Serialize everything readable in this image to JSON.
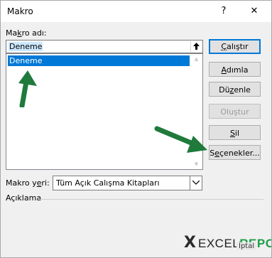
{
  "window": {
    "title": "Makro",
    "help_label": "?",
    "close_label": "✕"
  },
  "macro_name": {
    "label_pre": "Ma",
    "label_accel": "k",
    "label_post": "ro adı:",
    "value": "Deneme"
  },
  "macro_list": {
    "items": [
      "Deneme"
    ],
    "selected_index": 0
  },
  "buttons": {
    "run": {
      "pre": "",
      "accel": "Ç",
      "post": "alıştır"
    },
    "step": {
      "pre": "",
      "accel": "A",
      "post": "dımla"
    },
    "edit": {
      "pre": "Dü",
      "accel": "z",
      "post": "enle"
    },
    "create": {
      "pre": "Oluştur",
      "accel": "",
      "post": ""
    },
    "delete": {
      "pre": "",
      "accel": "S",
      "post": "il"
    },
    "options": {
      "pre": "S",
      "accel": "e",
      "post": "çenekler..."
    }
  },
  "macro_location": {
    "label_pre": "Makro y",
    "label_accel": "e",
    "label_post": "ri:",
    "value": "Tüm Açık Calışma Kitapları"
  },
  "description": {
    "label": "Açıklama"
  },
  "watermark": {
    "mark": "X",
    "part1": "EXCEL",
    "part2": "REPO",
    "partial_button": "İptal"
  },
  "colors": {
    "selection": "#0078d7",
    "arrow": "#1f7a3c",
    "primary_border": "#0078d7"
  }
}
